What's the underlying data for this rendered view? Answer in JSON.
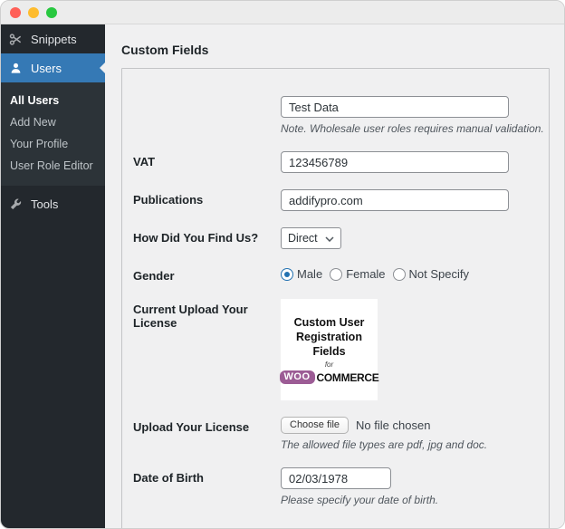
{
  "colors": {
    "sidebar_bg": "#23282d",
    "submenu_bg": "#2c3338",
    "active_blue": "#3579b5",
    "radio_blue": "#2271b1",
    "woo_purple": "#9c5c95",
    "content_bg": "#f0f0f1",
    "panel_border": "#c3c4c7"
  },
  "titlebar": {
    "close": "close",
    "minimize": "minimize",
    "zoom": "zoom"
  },
  "sidebar": {
    "snippets": {
      "label": "Snippets",
      "icon": "scissors-icon"
    },
    "users": {
      "label": "Users",
      "icon": "user-icon"
    },
    "submenu": [
      "All Users",
      "Add New",
      "Your Profile",
      "User Role Editor"
    ],
    "tools": {
      "label": "Tools",
      "icon": "wrench-icon"
    }
  },
  "page": {
    "heading": "Custom Fields"
  },
  "form": {
    "wholesale": {
      "value": "Test Data",
      "note": "Note. Wholesale user roles requires manual validation."
    },
    "vat": {
      "label": "VAT",
      "value": "123456789"
    },
    "publications": {
      "label": "Publications",
      "value": "addifypro.com"
    },
    "source": {
      "label": "How Did You Find Us?",
      "selected": "Direct"
    },
    "gender": {
      "label": "Gender",
      "options": [
        "Male",
        "Female",
        "Not Specify"
      ],
      "selected": "Male"
    },
    "current_license": {
      "label": "Current Upload Your License",
      "image_line1": "Custom User",
      "image_line2": "Registration Fields",
      "image_for": "for",
      "image_logo_woo": "WOO",
      "image_logo_commerce": "COMMERCE"
    },
    "upload_license": {
      "label": "Upload Your License",
      "button": "Choose file",
      "status": "No file chosen",
      "note": "The allowed file types are pdf, jpg and doc."
    },
    "dob": {
      "label": "Date of Birth",
      "value": "02/03/1978",
      "note": "Please specify your date of birth."
    }
  }
}
